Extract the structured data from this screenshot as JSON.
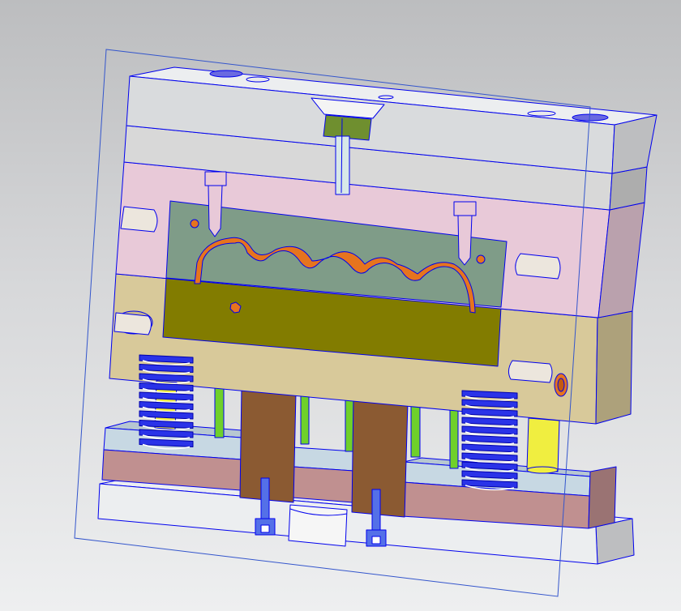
{
  "view": {
    "title": "",
    "background_top": "#bcbdbf",
    "background_bottom": "#eeeff0",
    "outline_color": "#0000ee",
    "section_plane_color": "#3355cc"
  },
  "parts": [
    {
      "name": "clamp-plate-top",
      "color": "#eceef0"
    },
    {
      "name": "stripper-plate",
      "color": "#d8d8d8"
    },
    {
      "name": "cavity-plate",
      "color": "#e8c9d8"
    },
    {
      "name": "cavity-insert",
      "color": "#7f9c88"
    },
    {
      "name": "core-insert",
      "color": "#827c00"
    },
    {
      "name": "core-plate",
      "color": "#d8c99a"
    },
    {
      "name": "support-block",
      "color": "#8b5a32"
    },
    {
      "name": "ejector-retainer-plate",
      "color": "#c7d8e3"
    },
    {
      "name": "ejector-plate",
      "color": "#c09090"
    },
    {
      "name": "clamp-plate-bottom",
      "color": "#eceef0"
    },
    {
      "name": "sprue-bushing",
      "color": "#6f8f2f"
    },
    {
      "name": "part-outline",
      "color": "#e6741e"
    },
    {
      "name": "return-spring",
      "color": "#2a33e8"
    },
    {
      "name": "ejector-pin",
      "color": "#6fd02a"
    },
    {
      "name": "guide-pillar",
      "color": "#f0ee40"
    },
    {
      "name": "socket-screw",
      "color": "#5470e8"
    }
  ]
}
